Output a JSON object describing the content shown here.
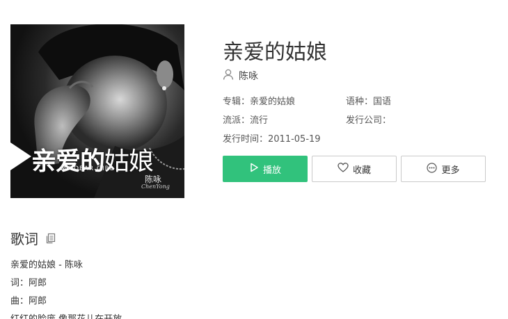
{
  "cover": {
    "title_bold": "亲爱的",
    "title_thin": "姑娘",
    "subtitle": "MY DEAR GIRL",
    "artist": "陈咏",
    "artist_en": "ChenYong"
  },
  "song": {
    "title": "亲爱的姑娘",
    "singer": "陈咏"
  },
  "meta": {
    "album_label": "专辑：",
    "album_value": "亲爱的姑娘",
    "language_label": "语种：",
    "language_value": "国语",
    "genre_label": "流派：",
    "genre_value": "流行",
    "company_label": "发行公司：",
    "company_value": "",
    "release_label": "发行时间：",
    "release_value": "2011-05-19"
  },
  "buttons": {
    "play": "播放",
    "favorite": "收藏",
    "more": "更多"
  },
  "lyrics": {
    "heading": "歌词",
    "lines": [
      "亲爱的姑娘 - 陈咏",
      "词：阿郎",
      "曲：阿郎",
      "红红的脸庞 像那花儿在开放"
    ]
  },
  "colors": {
    "accent": "#31c27c",
    "text": "#333333",
    "border": "#c9c9c9"
  }
}
